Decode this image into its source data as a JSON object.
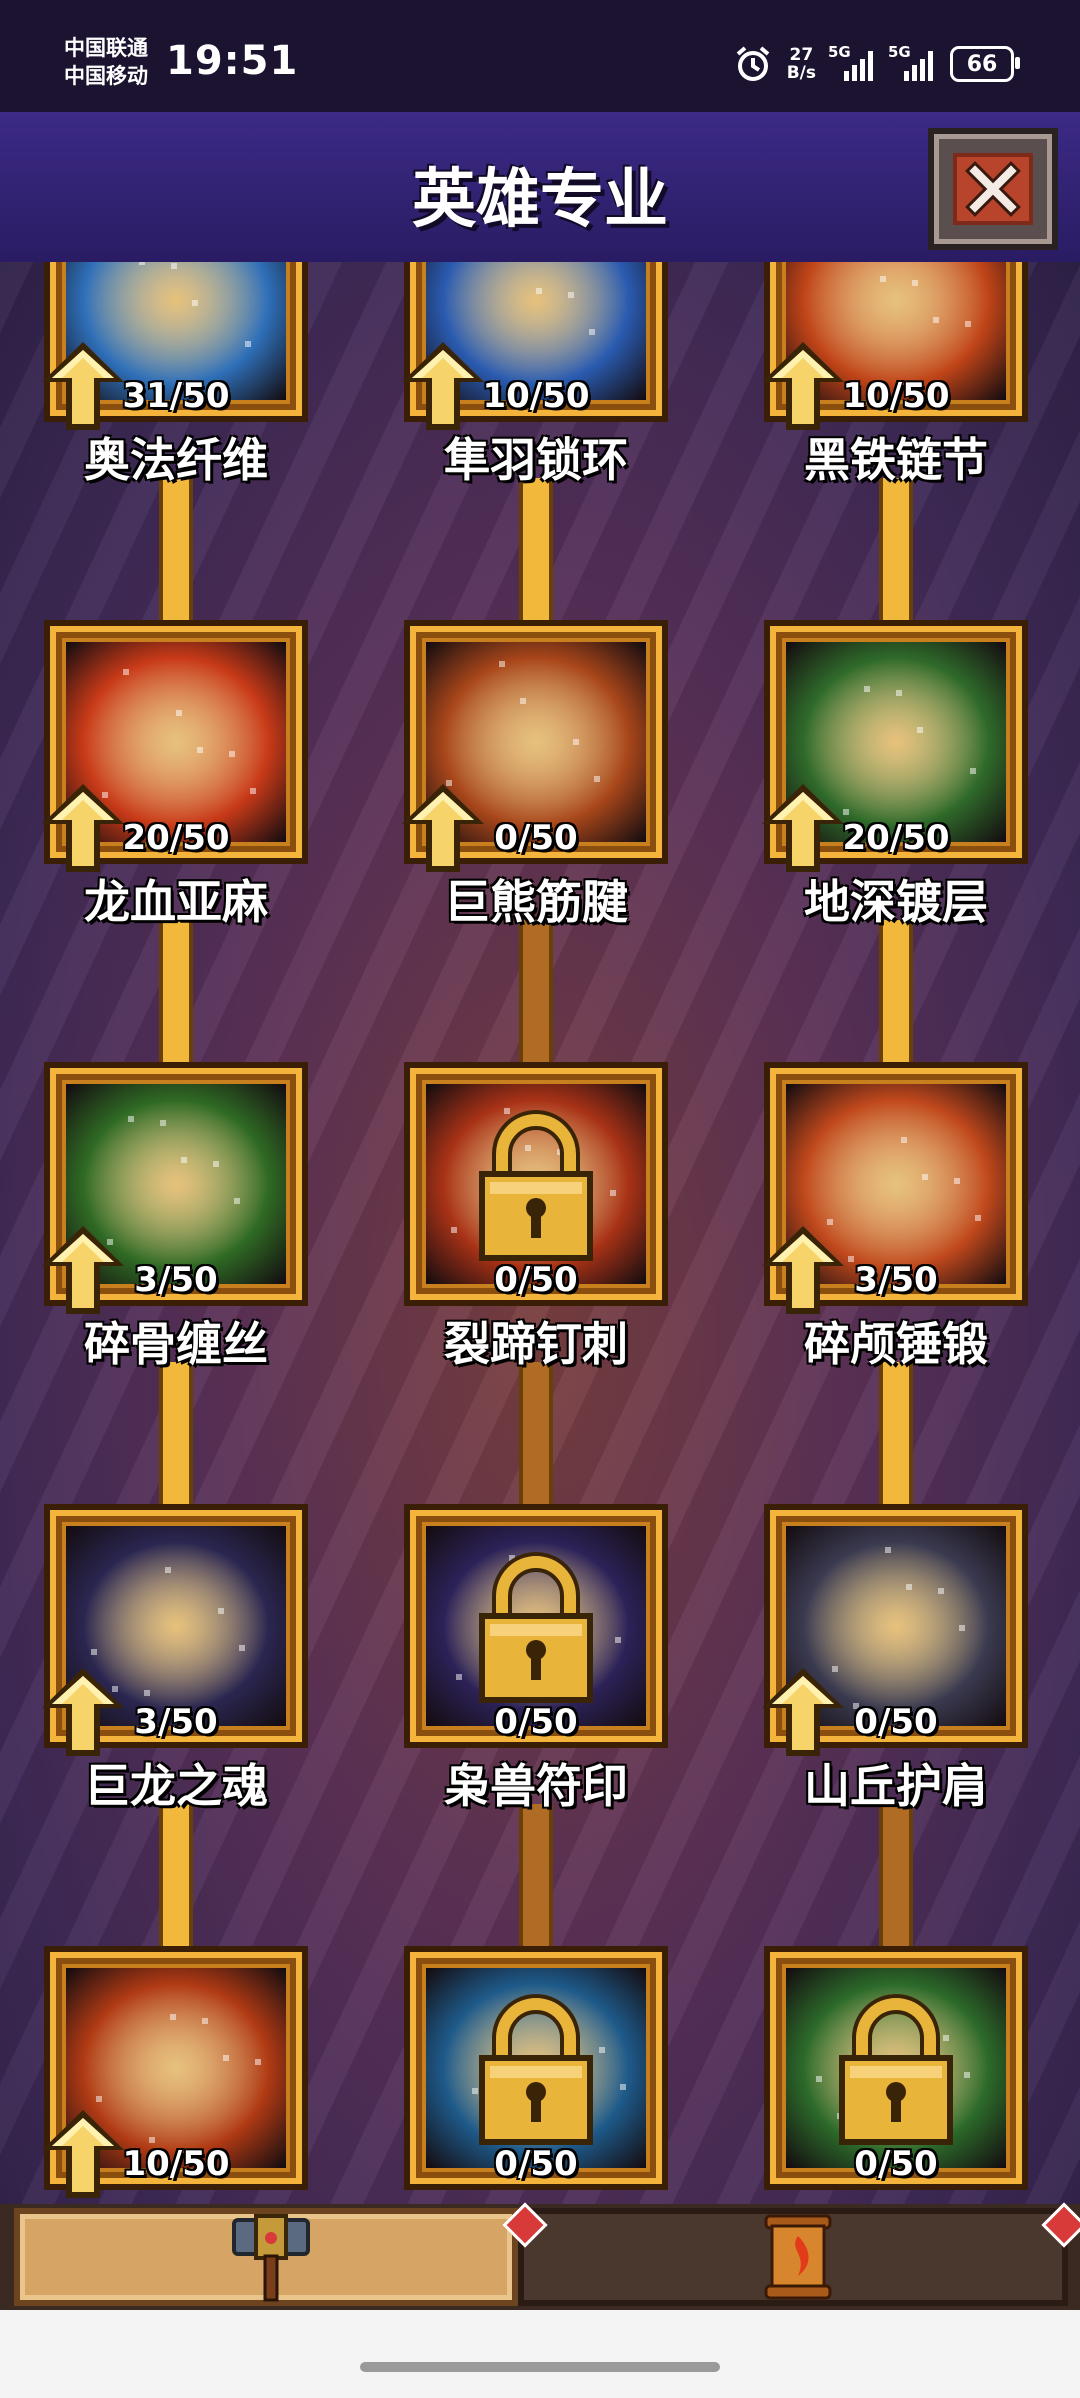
{
  "status_bar": {
    "carrier_1": "中国联通",
    "carrier_2": "中国移动",
    "time": "19:51",
    "net_speed_value": "27",
    "net_speed_unit": "B/s",
    "signal_1_label": "5G",
    "signal_2_label": "5G",
    "battery": "66"
  },
  "header": {
    "title": "英雄专业",
    "close_icon": "close-icon"
  },
  "skills": [
    {
      "name": "奥法纤维",
      "level": "31/50",
      "level_fraction": 0.62,
      "upgradeable": true,
      "locked": false,
      "icon": "arcane-fiber-icon",
      "color": "#2e6fb8"
    },
    {
      "name": "隼羽锁环",
      "level": "10/50",
      "level_fraction": 0.2,
      "upgradeable": true,
      "locked": false,
      "icon": "falcon-feather-icon",
      "color": "#2a5bb0"
    },
    {
      "name": "黑铁链节",
      "level": "10/50",
      "level_fraction": 0.2,
      "upgradeable": true,
      "locked": false,
      "icon": "iron-chain-icon",
      "color": "#c04418"
    },
    {
      "name": "龙血亚麻",
      "level": "20/50",
      "level_fraction": 0.4,
      "upgradeable": true,
      "locked": false,
      "icon": "dragon-blood-icon",
      "color": "#c83a18"
    },
    {
      "name": "巨熊筋腱",
      "level": "0/50",
      "level_fraction": 0,
      "upgradeable": true,
      "locked": false,
      "icon": "bear-paw-icon",
      "color": "#a8461a"
    },
    {
      "name": "地深镀层",
      "level": "20/50",
      "level_fraction": 0.4,
      "upgradeable": true,
      "locked": false,
      "icon": "earth-plating-icon",
      "color": "#2f6a2a"
    },
    {
      "name": "碎骨缠丝",
      "level": "3/50",
      "level_fraction": 0.06,
      "upgradeable": true,
      "locked": false,
      "icon": "bone-skull-icon",
      "color": "#2f6a24"
    },
    {
      "name": "裂蹄钉刺",
      "level": "0/50",
      "level_fraction": 0,
      "upgradeable": false,
      "locked": true,
      "icon": "lock-icon",
      "color": "#a83216"
    },
    {
      "name": "碎颅锤锻",
      "level": "3/50",
      "level_fraction": 0.06,
      "upgradeable": true,
      "locked": false,
      "icon": "hammer-icon",
      "color": "#c0481c"
    },
    {
      "name": "巨龙之魂",
      "level": "3/50",
      "level_fraction": 0.06,
      "upgradeable": true,
      "locked": false,
      "icon": "dragon-soul-icon",
      "color": "#2a2650"
    },
    {
      "name": "枭兽符印",
      "level": "0/50",
      "level_fraction": 0,
      "upgradeable": false,
      "locked": true,
      "icon": "lock-icon",
      "color": "#2c2258"
    },
    {
      "name": "山丘护肩",
      "level": "0/50",
      "level_fraction": 0,
      "upgradeable": true,
      "locked": false,
      "icon": "mountain-pauldron-icon",
      "color": "#3a3a50"
    },
    {
      "name": "",
      "level": "10/50",
      "level_fraction": 0.2,
      "upgradeable": true,
      "locked": false,
      "icon": "anvil-fire-icon",
      "color": "#b03a14"
    },
    {
      "name": "",
      "level": "0/50",
      "level_fraction": 0,
      "upgradeable": false,
      "locked": true,
      "icon": "lock-icon",
      "color": "#1e5a8a"
    },
    {
      "name": "",
      "level": "0/50",
      "level_fraction": 0,
      "upgradeable": false,
      "locked": true,
      "icon": "lock-icon",
      "color": "#2c6a2a"
    }
  ],
  "tabs": [
    {
      "icon": "hammer-tab-icon",
      "selected": true
    },
    {
      "icon": "scroll-tab-icon",
      "selected": false
    }
  ],
  "colors": {
    "gold": "#f2b83c",
    "header_purple": "#3c2a86",
    "close_red": "#b8442c"
  }
}
